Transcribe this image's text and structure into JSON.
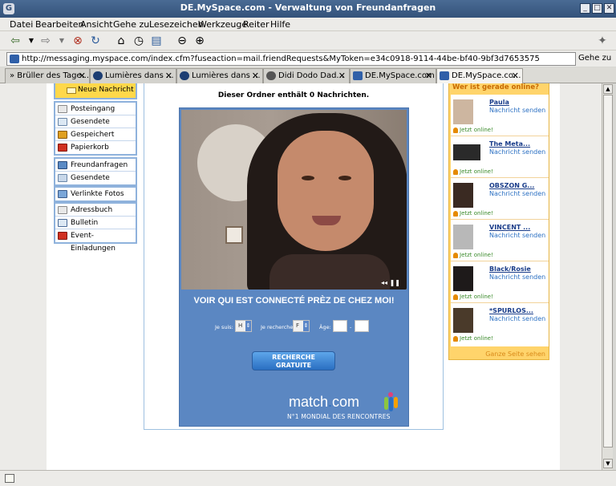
{
  "window": {
    "title": "DE.MySpace.com - Verwaltung von Freundanfragen",
    "buttons": [
      "_",
      "□",
      "✕"
    ]
  },
  "menubar": [
    "Datei",
    "Bearbeiten",
    "Ansicht",
    "Gehe zu",
    "Lesezeichen",
    "Werkzeuge",
    "Reiter",
    "Hilfe"
  ],
  "address": {
    "url": "http://messaging.myspace.com/index.cfm?fuseaction=mail.friendRequests&MyToken=e34c0918-9114-44be-bf40-9bf3d7653575",
    "go_label": "Gehe zu"
  },
  "tabs": [
    {
      "label": "» Brüller des Tage...",
      "icon": "none"
    },
    {
      "label": "Lumières dans ...",
      "icon": "globe"
    },
    {
      "label": "Lumières dans ...",
      "icon": "globe"
    },
    {
      "label": "Didi Dodo Dad...",
      "icon": "wordpress"
    },
    {
      "label": "DE.MySpace.com",
      "icon": "myspace"
    },
    {
      "label": "DE.MySpace.co...",
      "icon": "myspace"
    }
  ],
  "mail_menu": {
    "new_message": "Neue Nachricht",
    "group1": [
      "Posteingang",
      "Gesendete",
      "Gespeichert",
      "Papierkorb"
    ],
    "group2": [
      "Freundanfragen",
      "Gesendete Anfragen"
    ],
    "group3": [
      "Verlinkte Fotos"
    ],
    "group4": [
      "Adressbuch",
      "Bulletin",
      "Event-Einladungen"
    ]
  },
  "folder_status": "Dieser Ordner enthält 0 Nachrichten.",
  "ad": {
    "headline": "VOIR QUI EST CONNECTÉ PRÈZ DE CHEZ MOI!",
    "je_suis_label": "Je suis:",
    "je_suis_value": "H",
    "je_recherche_label": "Je recherche:",
    "je_recherche_value": "F",
    "age_label": "Âge:",
    "age_sep": "-",
    "button_line1": "RECHERCHE",
    "button_line2": "GRATUITE",
    "logo_main": "match",
    "logo_dot": ".",
    "logo_tld": "com",
    "tagline": "N°1 MONDIAL DES RENCONTRES"
  },
  "online_panel": {
    "heading": "Wer ist gerade online?",
    "friends": [
      {
        "name": "Paula",
        "action": "Nachricht senden",
        "status": "Jetzt online!"
      },
      {
        "name": "The Meta...",
        "action": "Nachricht senden",
        "status": "Jetzt online!"
      },
      {
        "name": "OBSZON G...",
        "action": "Nachricht senden",
        "status": "Jetzt online!"
      },
      {
        "name": "VINCENT ...",
        "action": "Nachricht senden",
        "status": "Jetzt online!"
      },
      {
        "name": "Black/Rosie",
        "action": "Nachricht senden",
        "status": "Jetzt online!"
      },
      {
        "name": "*SPURLOS...",
        "action": "Nachricht senden",
        "status": "Jetzt online!"
      }
    ],
    "see_all": "Ganze Seite sehen"
  }
}
